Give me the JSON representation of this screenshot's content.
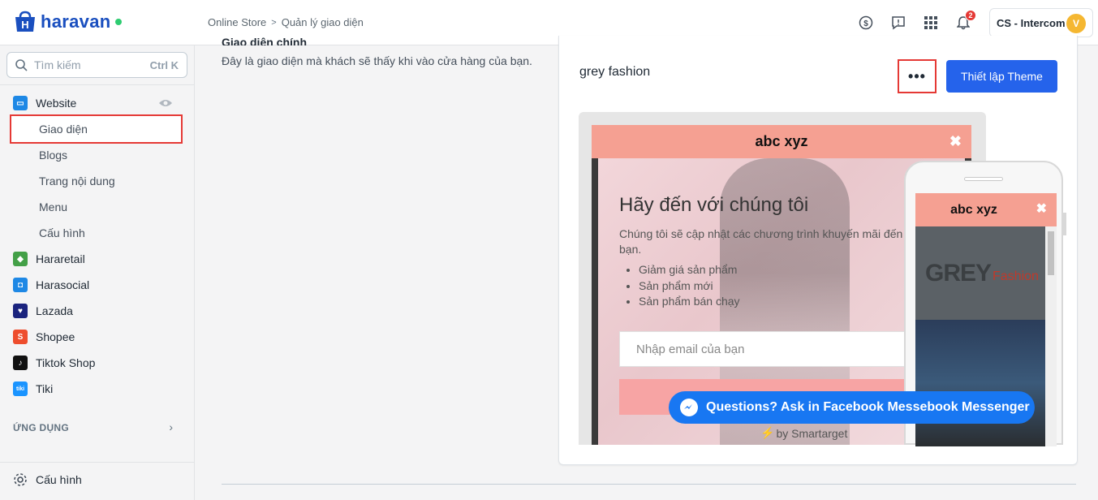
{
  "app": {
    "logo_text": "haravan"
  },
  "breadcrumb": {
    "items": [
      "Online Store",
      "Quản lý giao diện"
    ]
  },
  "topbar": {
    "notification_count": "2",
    "account_name": "CS - Intercom",
    "avatar_initial": "V"
  },
  "sidebar": {
    "search_placeholder": "Tìm kiếm",
    "search_shortcut": "Ctrl K",
    "website_label": "Website",
    "website_sub": [
      "Giao diện",
      "Blogs",
      "Trang nội dung",
      "Menu",
      "Cấu hình"
    ],
    "channels": [
      "Hararetail",
      "Harasocial",
      "Lazada",
      "Shopee",
      "Tiktok Shop",
      "Tiki"
    ],
    "apps_label": "ỨNG DỤNG",
    "settings_label": "Cấu hình"
  },
  "main": {
    "intro_title": "Giao diện chính",
    "intro_desc": "Đây là giao diện mà khách sẽ thấy khi vào cửa hàng của bạn.",
    "theme_name": "grey fashion",
    "more_label": "•••",
    "setup_button": "Thiết lập Theme"
  },
  "preview": {
    "popup_title": "abc xyz",
    "close_glyph": "✖",
    "hero_title": "Hãy đến với chúng tôi",
    "hero_sub": "Chúng tôi sẽ cập nhật các chương trình khuyến mãi đến bạn.",
    "hero_list": [
      "Giảm giá sản phẩm",
      "Sản phẩm mới",
      "Sản phẩm bán chạy"
    ],
    "email_placeholder": "Nhập email của bạn",
    "powered_by": "by Smartarget",
    "messenger_text": "Questions? Ask in Facebook Messebook Messenger",
    "mobile_popup_title": "abc xyz",
    "mobile_logo_main": "GREY",
    "mobile_logo_sub": "Fashion"
  },
  "colors": {
    "brand": "#1a4fbf",
    "primary_button": "#2563eb",
    "highlight_border": "#e53935",
    "popup_bar": "#f5a092",
    "messenger": "#1877f2"
  }
}
